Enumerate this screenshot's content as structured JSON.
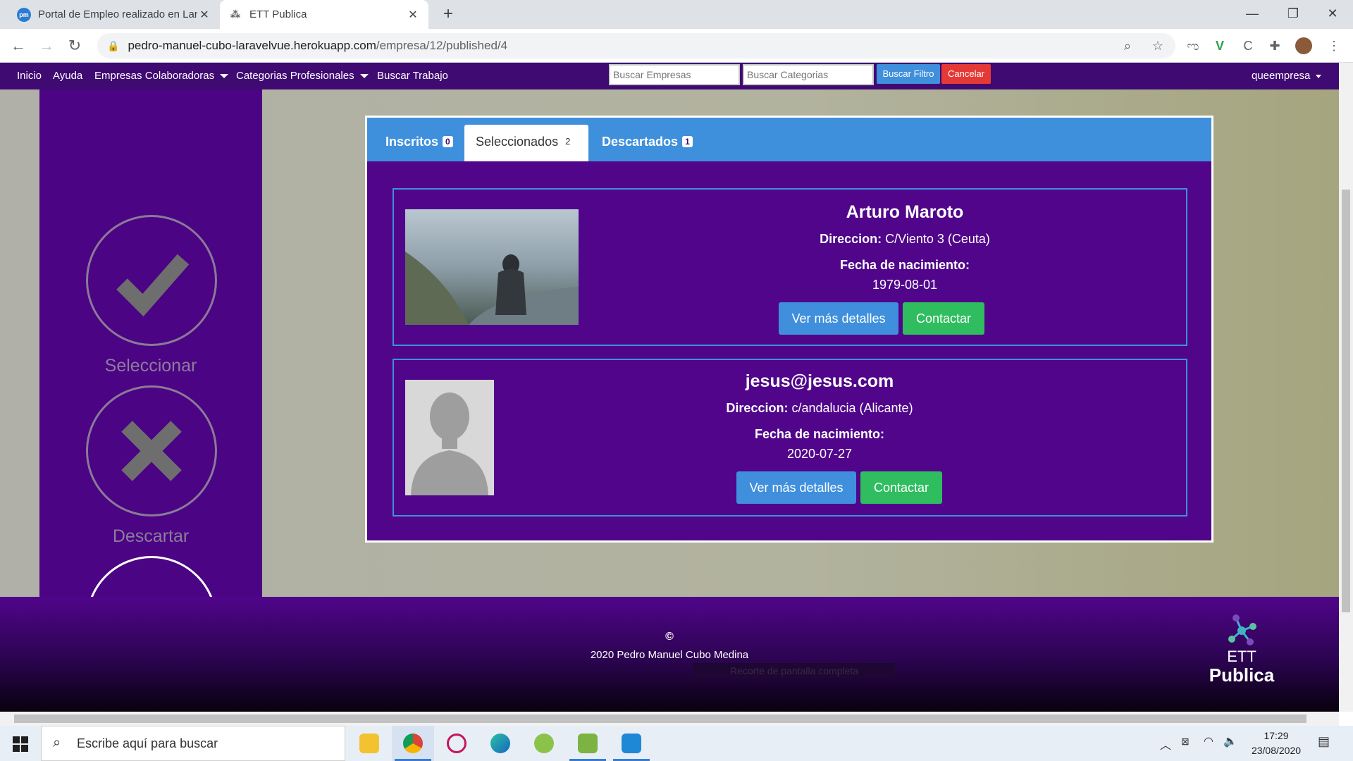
{
  "browser": {
    "tabs": [
      {
        "title": "Portal de Empleo realizado en Lar",
        "favicon": "pm",
        "close": "✕"
      },
      {
        "title": "ETT Publica",
        "close": "✕"
      }
    ],
    "new_tab": "+",
    "window_controls": {
      "minimize": "—",
      "restore": "❐",
      "close": "✕"
    },
    "url_host": "pedro-manuel-cubo-laravelvue.herokuapp.com",
    "url_path": "/empresa/12/published/4"
  },
  "nav": {
    "items": [
      "Inicio",
      "Ayuda",
      "Empresas Colaboradoras",
      "Categorias Profesionales",
      "Buscar Trabajo"
    ],
    "search_companies_placeholder": "Buscar Empresas",
    "search_categories_placeholder": "Buscar Categorias",
    "filter_button": "Buscar Filtro",
    "cancel_button": "Cancelar",
    "user": "queempresa"
  },
  "sidebar": {
    "select_label": "Seleccionar",
    "discard_label": "Descartar"
  },
  "tabs": {
    "inscritos": {
      "label": "Inscritos",
      "count": "0"
    },
    "seleccionados": {
      "label": "Seleccionados",
      "count": "2"
    },
    "descartados": {
      "label": "Descartados",
      "count": "1"
    }
  },
  "candidates": [
    {
      "name": "Arturo Maroto",
      "address_label": "Direccion:",
      "address": "C/Viento 3 (Ceuta)",
      "birth_label": "Fecha de nacimiento:",
      "birth": "1979-08-01",
      "details_button": "Ver más detalles",
      "contact_button": "Contactar"
    },
    {
      "name": "jesus@jesus.com",
      "address_label": "Direccion:",
      "address": "c/andalucia (Alicante)",
      "birth_label": "Fecha de nacimiento:",
      "birth": "2020-07-27",
      "details_button": "Ver más detalles",
      "contact_button": "Contactar"
    }
  ],
  "footer": {
    "copyright_symbol": "©",
    "copyright": "2020 Pedro Manuel Cubo Medina",
    "logo_top": "ETT",
    "logo_bottom": "Publica",
    "overlay_text": "Recorte de pantalla completa"
  },
  "taskbar": {
    "search_placeholder": "Escribe aquí para buscar",
    "time": "17:29",
    "date": "23/08/2020"
  },
  "colors": {
    "nav_bg": "#3f0a72",
    "panel_bg": "#50058a",
    "tab_blue": "#3f90dc",
    "button_blue": "#3f8fdc",
    "button_green": "#2fbd5f",
    "cancel_red": "#e53935"
  }
}
